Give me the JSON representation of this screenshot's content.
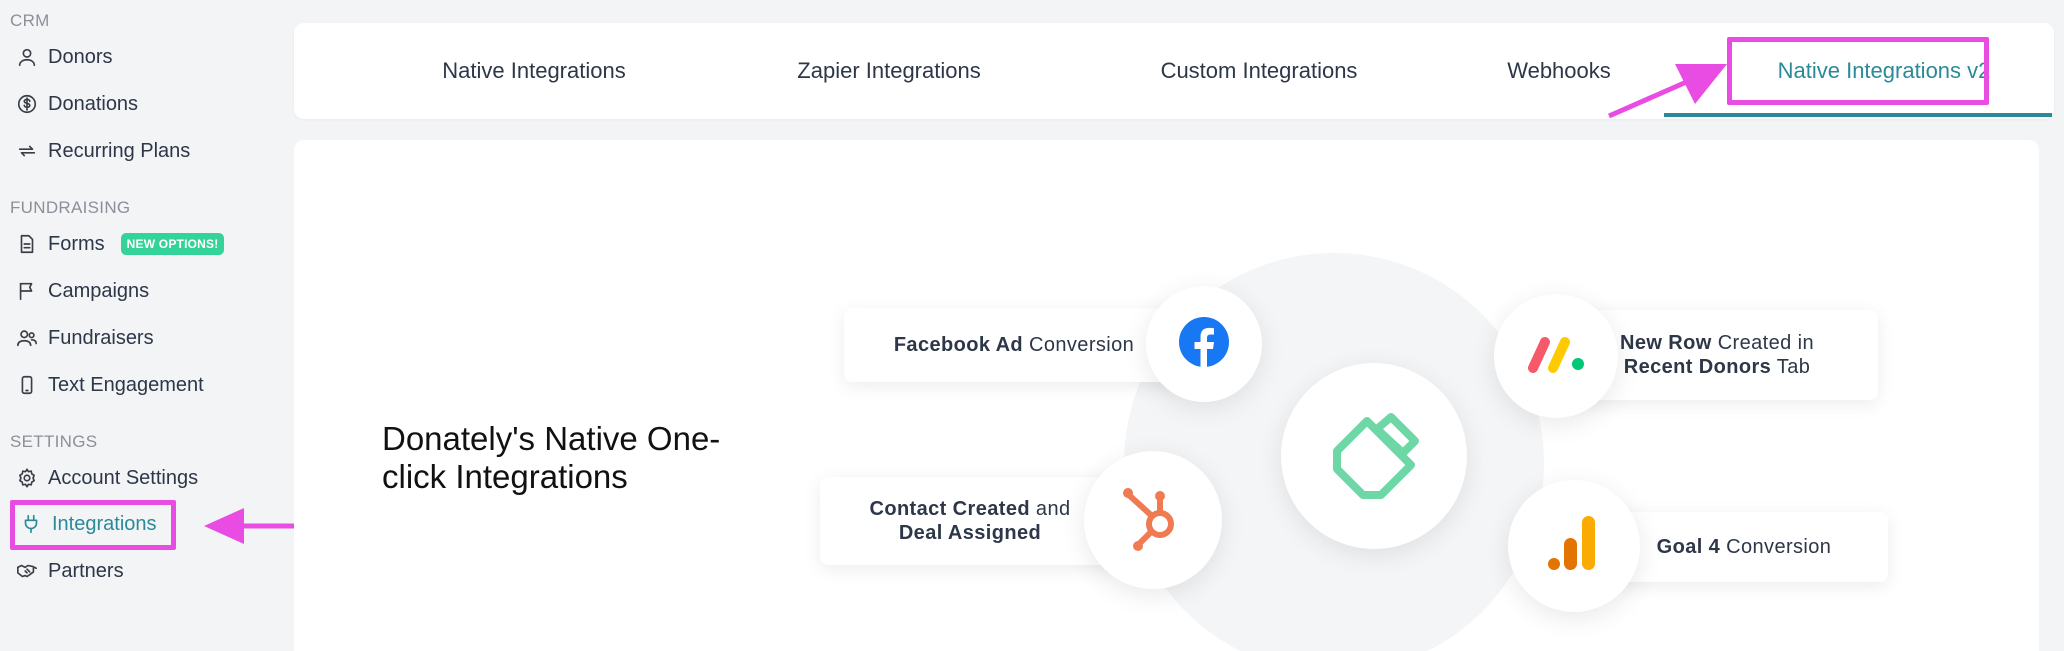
{
  "sidebar": {
    "sections": {
      "crm": "CRM",
      "fundraising": "FUNDRAISING",
      "settings": "SETTINGS"
    },
    "items": [
      {
        "label": "Donors",
        "icon": "user-icon"
      },
      {
        "label": "Donations",
        "icon": "dollar-circle-icon"
      },
      {
        "label": "Recurring Plans",
        "icon": "repeat-icon"
      },
      {
        "label": "Forms",
        "icon": "document-icon",
        "badge": "NEW OPTIONS!"
      },
      {
        "label": "Campaigns",
        "icon": "flag-icon"
      },
      {
        "label": "Fundraisers",
        "icon": "users-icon"
      },
      {
        "label": "Text Engagement",
        "icon": "mobile-icon"
      },
      {
        "label": "Account Settings",
        "icon": "gear-icon"
      },
      {
        "label": "Integrations",
        "icon": "plug-icon",
        "active": true
      },
      {
        "label": "Partners",
        "icon": "handshake-icon"
      }
    ]
  },
  "tabs": [
    {
      "label": "Native Integrations"
    },
    {
      "label": "Zapier Integrations"
    },
    {
      "label": "Custom Integrations"
    },
    {
      "label": "Webhooks"
    },
    {
      "label": "Native Integrations v2",
      "active": true
    }
  ],
  "hero": {
    "title": "Donately's Native One-click Integrations"
  },
  "integrations": {
    "facebook": {
      "bold": "Facebook Ad",
      "rest": " Conversion",
      "icon": "facebook-icon"
    },
    "hubspot": {
      "bold1": "Contact Created",
      "mid": " and",
      "bold2": "Deal Assigned",
      "icon": "hubspot-icon"
    },
    "monday": {
      "bold1": "New Row",
      "mid": " Created in",
      "bold2": "Recent Donors",
      "rest": " Tab",
      "icon": "monday-icon"
    },
    "analytics": {
      "bold": "Goal 4",
      "rest": " Conversion",
      "icon": "google-analytics-icon"
    },
    "center": {
      "icon": "donately-logo-icon"
    }
  },
  "colors": {
    "accent": "#2a8a98",
    "highlight": "#e94ce3",
    "badge": "#34d399",
    "facebook": "#1877f2",
    "hubspot": "#f07b52",
    "donately": "#6dd7a6"
  }
}
